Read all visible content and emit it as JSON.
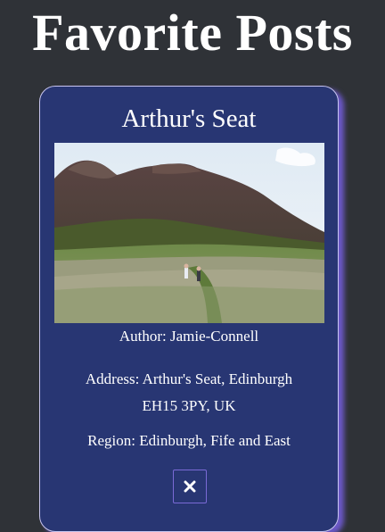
{
  "page": {
    "title": "Favorite Posts"
  },
  "post": {
    "title": "Arthur's Seat",
    "image_alt": "Arthur's Seat",
    "author": "Author: Jamie-Connell",
    "address_line1": "Address: Arthur's Seat, Edinburgh",
    "address_line2": "EH15 3PY, UK",
    "region": "Region: Edinburgh, Fife and East",
    "remove_icon": "close-icon"
  },
  "colors": {
    "background": "#2f3237",
    "card": "#283673",
    "card_border": "#c7c5ef",
    "card_glow": "#6c58c9",
    "button_border": "#7a6ad6"
  }
}
